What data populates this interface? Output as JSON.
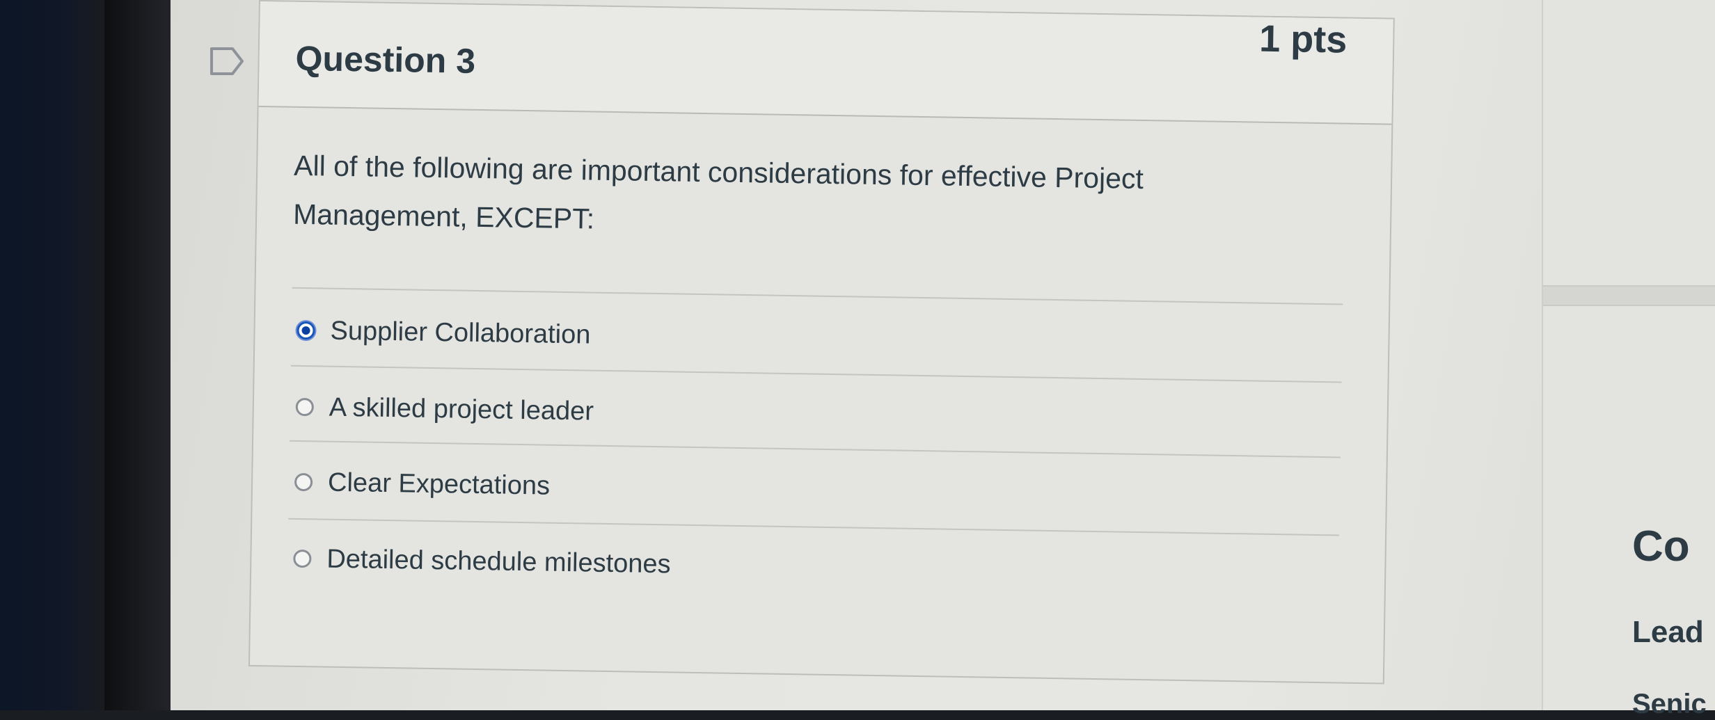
{
  "question": {
    "title": "Question 3",
    "points": "1 pts",
    "text": "All of the following are important considerations for effective Project Management, EXCEPT:",
    "answers": [
      {
        "label": "Supplier Collaboration",
        "selected": true
      },
      {
        "label": "A skilled project leader",
        "selected": false
      },
      {
        "label": "Clear Expectations",
        "selected": false
      },
      {
        "label": "Detailed schedule milestones",
        "selected": false
      }
    ]
  },
  "side_panel": {
    "heading": "Co",
    "subheading": "Lead",
    "subheading2": "Senic"
  },
  "colors": {
    "text": "#2d3b45",
    "selected_radio": "#0b3fa0",
    "background": "#e4e4e0"
  },
  "icons": {
    "flag": "bookmark-flag-icon"
  }
}
